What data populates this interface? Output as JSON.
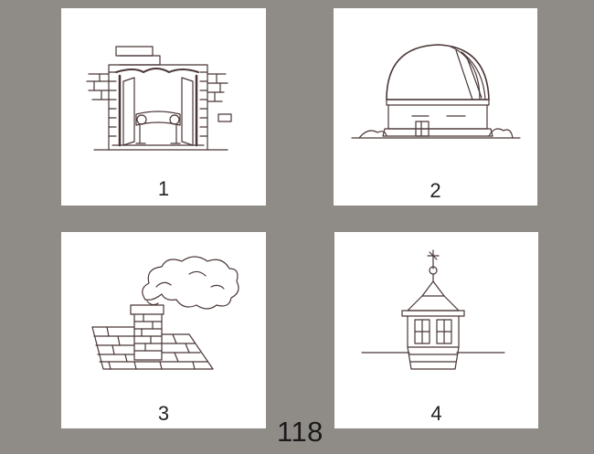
{
  "cards": [
    {
      "label": "1",
      "icon": "fireplace-icon"
    },
    {
      "label": "2",
      "icon": "observatory-dome-icon"
    },
    {
      "label": "3",
      "icon": "chimney-smoke-icon"
    },
    {
      "label": "4",
      "icon": "cupola-icon"
    }
  ],
  "page_number": "118",
  "colors": {
    "background": "#8f8c88",
    "card": "#ffffff",
    "ink": "#4a3636"
  }
}
